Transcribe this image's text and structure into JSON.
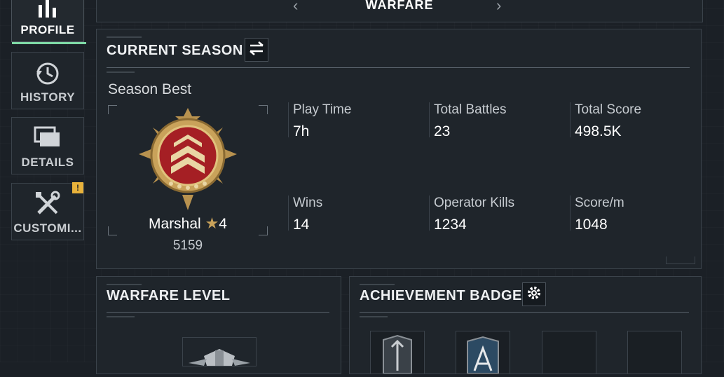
{
  "sidebar": {
    "items": [
      {
        "label": "PROFILE",
        "icon": "bar-chart-icon",
        "active": true
      },
      {
        "label": "HISTORY",
        "icon": "history-icon",
        "active": false
      },
      {
        "label": "DETAILS",
        "icon": "folder-icon",
        "active": false
      },
      {
        "label": "CUSTOMI...",
        "icon": "wrench-screwdriver-icon",
        "active": false,
        "alert": "!"
      }
    ]
  },
  "topbar": {
    "title": "WARFARE",
    "prev": "‹",
    "next": "›"
  },
  "current_season": {
    "title": "CURRENT SEASON",
    "subtitle": "Season Best",
    "rank_name": "Marshal",
    "rank_stars": "4",
    "rank_points": "5159",
    "stats": [
      {
        "label": "Play Time",
        "value": "7h"
      },
      {
        "label": "Total Battles",
        "value": "23"
      },
      {
        "label": "Total Score",
        "value": "498.5K"
      },
      {
        "label": "Wins",
        "value": "14"
      },
      {
        "label": "Operator Kills",
        "value": "1234"
      },
      {
        "label": "Score/m",
        "value": "1048"
      }
    ]
  },
  "warfare_level": {
    "title": "WARFARE LEVEL"
  },
  "achievement_badge": {
    "title": "ACHIEVEMENT BADGE"
  },
  "colors": {
    "accent": "#7fd9a6",
    "alert": "#e8b23b",
    "gold": "#c9a25a",
    "panel": "#1f252b"
  }
}
